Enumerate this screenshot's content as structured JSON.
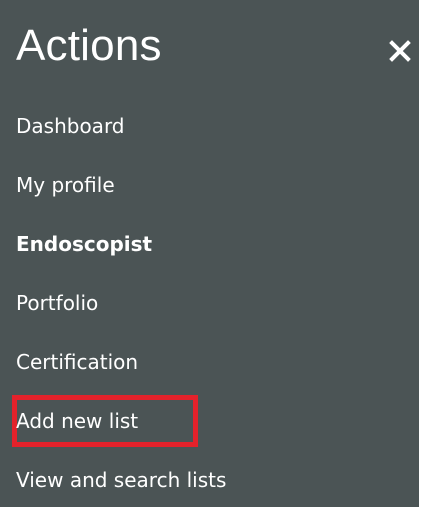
{
  "panel": {
    "title": "Actions",
    "close_icon": "close-icon"
  },
  "menu": {
    "items": [
      {
        "label": "Dashboard",
        "bold": false
      },
      {
        "label": "My profile",
        "bold": false
      },
      {
        "label": "Endoscopist",
        "bold": true
      },
      {
        "label": "Portfolio",
        "bold": false
      },
      {
        "label": "Certification",
        "bold": false
      },
      {
        "label": "Add new list",
        "bold": false,
        "highlighted": true
      },
      {
        "label": "View and search lists",
        "bold": false
      }
    ]
  },
  "colors": {
    "panel_background": "#4b5455",
    "text": "#ffffff",
    "highlight_border": "#e4222b"
  }
}
